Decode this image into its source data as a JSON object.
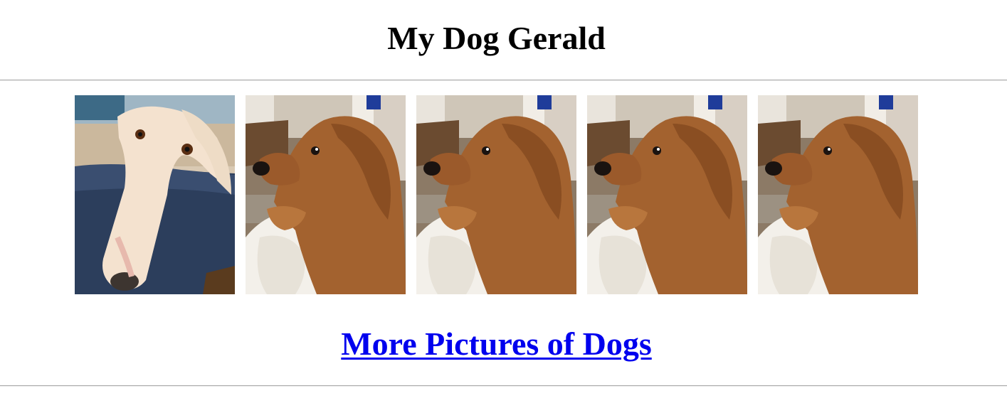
{
  "page": {
    "title": "My Dog Gerald",
    "link_text": "More Pictures of Dogs"
  },
  "gallery": {
    "photos": [
      {
        "subject": "borzoi",
        "icon": "dog-photo-borzoi"
      },
      {
        "subject": "golden-retriever",
        "icon": "dog-photo-golden"
      },
      {
        "subject": "golden-retriever",
        "icon": "dog-photo-golden"
      },
      {
        "subject": "golden-retriever",
        "icon": "dog-photo-golden"
      },
      {
        "subject": "golden-retriever",
        "icon": "dog-photo-golden"
      }
    ]
  },
  "colors": {
    "link": "#0000ee",
    "rule": "#a9a9a9",
    "background": "#ffffff"
  }
}
